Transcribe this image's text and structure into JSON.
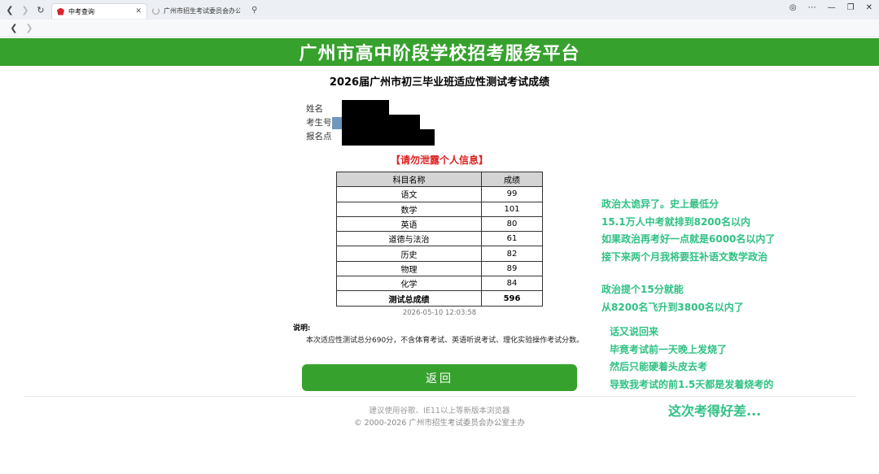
{
  "browser": {
    "tabs": [
      {
        "title": "中考查询",
        "close": "✕"
      },
      {
        "title": "广州市招生考试委员会办公室网站"
      }
    ],
    "nav_icons": [
      "back-icon",
      "forward-icon",
      "reload-icon",
      "search-icon",
      "globe-icon",
      "more-icon",
      "minimize-icon",
      "close-icon"
    ]
  },
  "header": {
    "banner_title": "广州市高中阶段学校招考服务平台",
    "page_heading": "2026届广州市初三毕业班适应性测试考试成绩"
  },
  "student_info": {
    "name_label": "姓名",
    "id_label": "考生号",
    "site_label": "报名点"
  },
  "warning": "【请勿泄露个人信息】",
  "score_table": {
    "headers": [
      "科目名称",
      "成绩"
    ],
    "rows": [
      {
        "subject": "语文",
        "score": "99"
      },
      {
        "subject": "数学",
        "score": "101"
      },
      {
        "subject": "英语",
        "score": "80"
      },
      {
        "subject": "道德与法治",
        "score": "61"
      },
      {
        "subject": "历史",
        "score": "82"
      },
      {
        "subject": "物理",
        "score": "89"
      },
      {
        "subject": "化学",
        "score": "84"
      }
    ],
    "total_label": "测试总成绩",
    "total_score": "596"
  },
  "timestamp": "2026-05-10 12:03:58",
  "note": {
    "label": "说明:",
    "text": "本次适应性测试总分690分，不含体育考试、英语听说考试、理化实验操作考试分数。"
  },
  "back_button": "返回",
  "footer": {
    "line1": "建议使用谷歌、IE11以上等新版本浏览器",
    "line2": "© 2000-2026 广州市招生考试委员会办公室主办"
  },
  "annotations": {
    "block1": [
      "政治太诡异了。史上最低分",
      "15.1万人中考就排到8200名以内",
      "如果政治再考好一点就是6000名以内了",
      "接下来两个月我将要狂补语文数学政治"
    ],
    "block2": [
      "政治提个15分就能",
      "从8200名飞升到3800名以内了"
    ],
    "block3": [
      "话又说回来",
      "毕竟考试前一天晚上发烧了",
      "然后只能硬着头皮去考",
      "导致我考试的前1.5天都是发着烧考的"
    ],
    "block4": "这次考得好差..."
  },
  "colors": {
    "brand_green": "#36a12d",
    "warning_red": "#e02020",
    "annotation_green": "#2fc184"
  }
}
